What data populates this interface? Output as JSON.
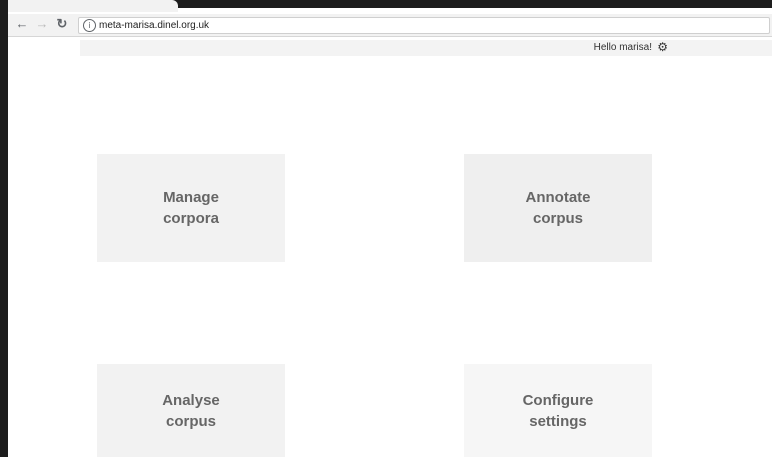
{
  "browser": {
    "url": "meta-marisa.dinel.org.uk",
    "back_icon": "arrow-left-icon",
    "forward_icon": "arrow-right-icon",
    "reload_icon": "reload-icon",
    "info_icon": "info-icon"
  },
  "header": {
    "greeting": "Hello marisa!",
    "settings_icon": "gear-icon"
  },
  "tiles": [
    {
      "line1": "Manage",
      "line2": "corpora"
    },
    {
      "line1": "Annotate",
      "line2": "corpus"
    },
    {
      "line1": "Analyse",
      "line2": "corpus"
    },
    {
      "line1": "Configure",
      "line2": "settings"
    }
  ]
}
